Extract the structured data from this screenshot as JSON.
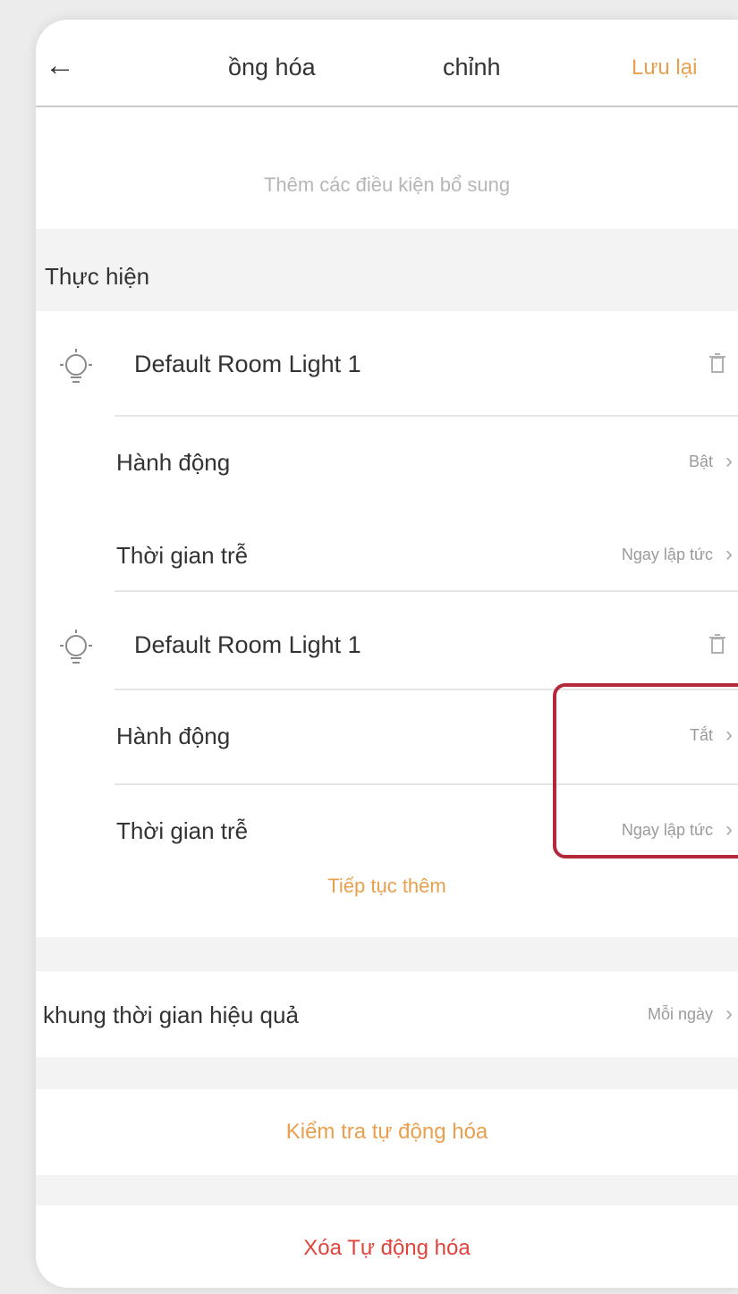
{
  "header": {
    "title_left": "ồng hóa",
    "title_right": "chỉnh",
    "save_label": "Lưu lại"
  },
  "conditions": {
    "add_more": "Thêm các điều kiện bổ sung"
  },
  "actions": {
    "section_label": "Thực hiện",
    "devices": [
      {
        "name": "Default Room Light 1",
        "icon": "bulb-icon",
        "action_label": "Hành động",
        "action_value": "Bật",
        "delay_label": "Thời gian trễ",
        "delay_value": "Ngay lập tức"
      },
      {
        "name": "Default Room Light 1",
        "icon": "bulb-icon",
        "action_label": "Hành động",
        "action_value": "Tắt",
        "delay_label": "Thời gian trễ",
        "delay_value": "Ngay lập tức"
      }
    ],
    "continue_add": "Tiếp tục thêm"
  },
  "effective_time": {
    "label": "khung thời gian hiệu quả",
    "value": "Mỗi ngày"
  },
  "test_label": "Kiểm tra tự động hóa",
  "delete_label": "Xóa Tự động hóa",
  "colors": {
    "accent": "#e9a04d",
    "danger": "#e0443c",
    "highlight": "#b22a3a"
  }
}
